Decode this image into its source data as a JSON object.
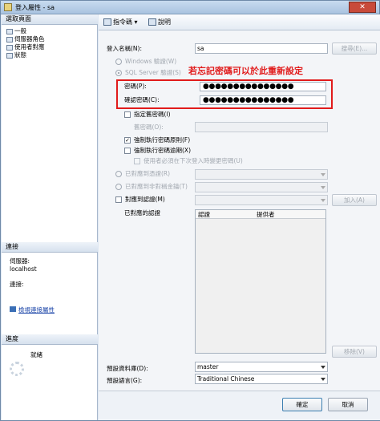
{
  "window": {
    "title": "登入屬性 - sa"
  },
  "left": {
    "select_page": "選取頁面",
    "nav": [
      "一般",
      "伺服器角色",
      "使用者對應",
      "狀態"
    ],
    "connection_header": "連接",
    "server_label": "伺服器:",
    "server_value": "localhost",
    "connect_label": "連接:",
    "view_conn": "檢視連接屬性",
    "progress_header": "進度",
    "status": "就緒"
  },
  "toolbar": {
    "script": "指令碼",
    "help": "說明"
  },
  "form": {
    "login_name_label": "登入名稱(N):",
    "login_name_value": "sa",
    "search_btn": "搜尋(E)...",
    "windows_auth": "Windows 驗證(W)",
    "sql_auth": "SQL Server 驗證(S)",
    "annotation": "若忘記密碼可以於此重新設定",
    "password_label": "密碼(P):",
    "password_value": "●●●●●●●●●●●●●●●",
    "confirm_label": "確認密碼(C):",
    "confirm_value": "●●●●●●●●●●●●●●●",
    "specify_old": "指定舊密碼(I)",
    "old_password": "舊密碼(O):",
    "enforce_policy": "強制執行密碼原則(F)",
    "enforce_expiry": "強制執行密碼逾期(X)",
    "must_change": "使用者必須在下次登入時變更密碼(U)",
    "cert": "已對應到憑證(R)",
    "asym": "已對應到非對稱金鑰(T)",
    "map_cred": "對應到認證(M)",
    "add_btn": "加入(A)",
    "mapped_creds": "已對應的認證",
    "col_cred": "認證",
    "col_provider": "提供者",
    "remove_btn": "移除(V)",
    "default_db_label": "預設資料庫(D):",
    "default_db": "master",
    "default_lang_label": "預設語言(G):",
    "default_lang": "Traditional Chinese"
  },
  "footer": {
    "ok": "確定",
    "cancel": "取消"
  },
  "colors": {
    "annotation": "#e11b1b"
  }
}
